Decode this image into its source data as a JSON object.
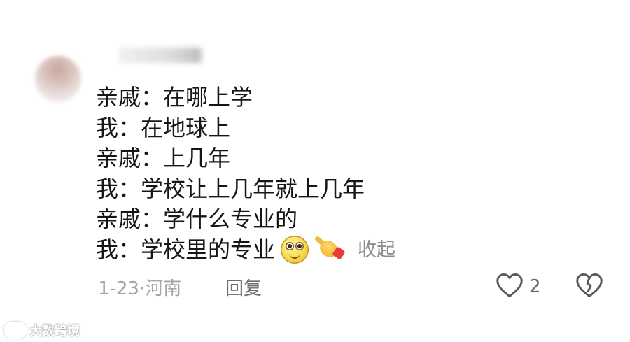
{
  "comment": {
    "lines": [
      "亲戚：在哪上学",
      "我：在地球上",
      "亲戚：上几年",
      "我：学校让上几年就上几年",
      "亲戚：学什么专业的",
      "我：学校里的专业"
    ],
    "emojis": [
      "smiling-face-emoji",
      "pointing-hand-emoji"
    ],
    "collapse_label": "收起"
  },
  "meta": {
    "date": "1-23",
    "separator": "·",
    "location": "河南",
    "reply_label": "回复"
  },
  "actions": {
    "like_icon": "heart-outline-icon",
    "like_count": "2",
    "dislike_icon": "broken-heart-icon"
  },
  "watermark": {
    "text": "大数跨境",
    "icon": "brand-logo-icon"
  },
  "colors": {
    "text": "#161616",
    "muted": "#a6a6a6",
    "collapse": "#8c8c8c",
    "reply": "#6e6e6e"
  }
}
